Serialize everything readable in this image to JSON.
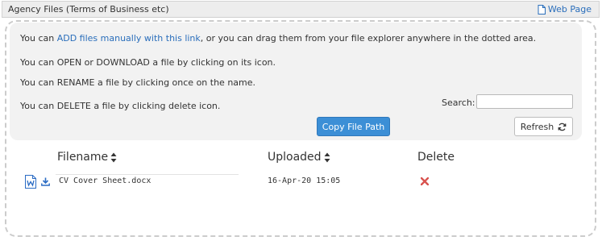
{
  "header": {
    "title": "Agency Files (Terms of Business etc)",
    "web_page_label": "Web Page"
  },
  "info": {
    "line1_prefix": "You can ",
    "line1_link": "ADD files manually with this link",
    "line1_suffix": ", or you can drag them from your file explorer anywhere in the dotted area.",
    "line2": "You can OPEN or DOWNLOAD a file by clicking on its icon.",
    "line3": "You can RENAME a file by clicking once on the name.",
    "line4": "You can DELETE a file by clicking delete icon."
  },
  "search": {
    "label": "Search:",
    "value": "",
    "placeholder": ""
  },
  "buttons": {
    "copy_path": "Copy File Path",
    "refresh": "Refresh"
  },
  "table": {
    "columns": [
      "Filename",
      "Uploaded",
      "Delete"
    ],
    "rows": [
      {
        "filename": "CV Cover Sheet.docx",
        "uploaded": "16-Apr-20 15:05"
      }
    ]
  },
  "colors": {
    "link": "#2a6ebb",
    "primary_button": "#3c8fd6",
    "delete": "#d9534f",
    "word": "#2b6cc4"
  },
  "icons": [
    "page-icon",
    "refresh-icon",
    "sort-icon",
    "word-file-icon",
    "download-icon",
    "delete-icon"
  ]
}
